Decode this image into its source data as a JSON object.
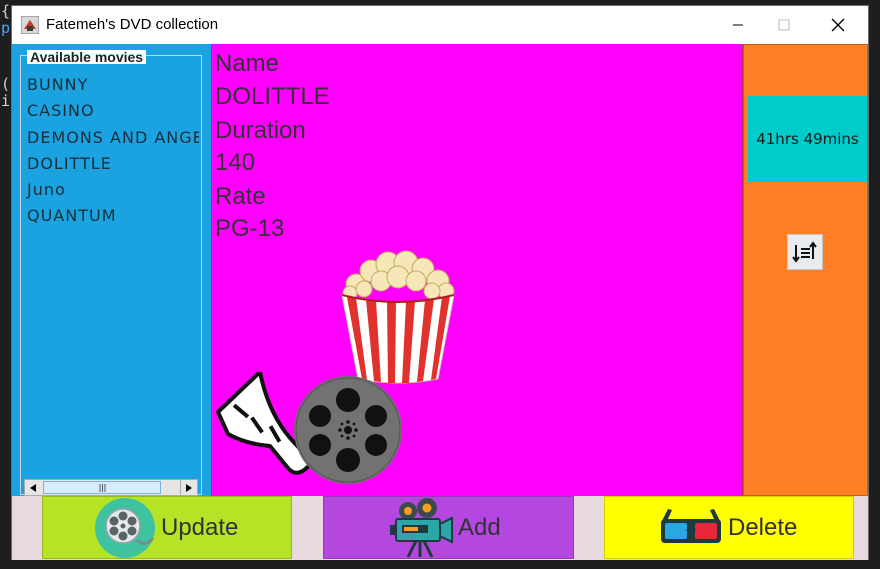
{
  "background": {
    "code_glyphs": [
      "{",
      "p",
      "(",
      "i"
    ]
  },
  "window": {
    "title": "Fatemeh's DVD collection",
    "controls": {
      "minimize": "—",
      "maximize": "☐",
      "close": "✕"
    }
  },
  "movies_panel": {
    "legend": "Available movies",
    "items": [
      "BUNNY",
      "CASINO",
      "DEMONS AND ANGELS",
      "DOLITTLE",
      "Juno",
      "QUANTUM"
    ]
  },
  "details": {
    "name_label": "Name",
    "name_value": "DOLITTLE",
    "duration_label": "Duration",
    "duration_value": "140",
    "rate_label": "Rate",
    "rate_value": "PG-13"
  },
  "summary": {
    "total_duration": "41hrs 49mins"
  },
  "actions": {
    "update_label": "Update",
    "add_label": "Add",
    "delete_label": "Delete"
  },
  "colors": {
    "list_bg": "#1aa3e0",
    "details_bg": "#ff00ff",
    "side_bg": "#ff7f24",
    "total_bg": "#00cccc",
    "update_bg": "#b5e325",
    "add_bg": "#b347e0",
    "delete_bg": "#ffff00"
  },
  "icons": {
    "app": "app-icon",
    "sort": "sort-icon",
    "update": "film-reel-icon",
    "add": "movie-camera-icon",
    "delete": "3d-glasses-icon"
  }
}
